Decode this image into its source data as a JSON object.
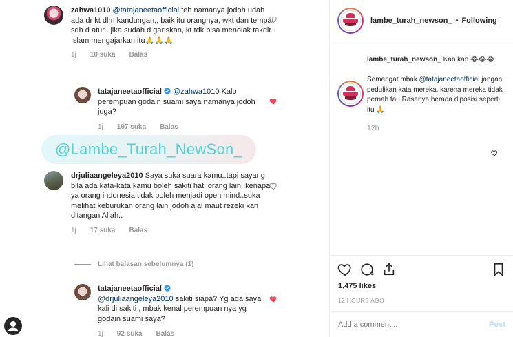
{
  "comments": [
    {
      "username": "zahwa1010",
      "mention": "@tatajaneetaofficial",
      "text": " teh namanya jodoh udah ada dr kt dlm kandungan,, baik itu orangnya, wkt dan tempat sdh d atur.. jika sudah d gariskan, kt tdk bisa menolak takdir.. Islam mengajarkan itu🙏🙏🙏",
      "time": "1j",
      "likes": "10 suka",
      "reply": "Balas"
    },
    {
      "username": "tatajaneetaofficial",
      "mention": "@zahwa1010",
      "text": " Kalo perempuan godain suami saya namanya jodoh juga?",
      "time": "1j",
      "likes": "197 suka",
      "reply": "Balas"
    },
    {
      "username": "drjuliaangeleya2010",
      "mention": "",
      "text": " Saya suka suara kamu..tapi sayang bila ada kata-kata kamu boleh sakiti hati orang lain..kenapa ya orang indonesia tidak boleh menjadi open mind..suka melihat keburukan orang lain jodoh ajal maut rezeki kan ditangan Allah..",
      "time": "1j",
      "likes": "17 suka",
      "reply": "Balas"
    },
    {
      "username": "tatajaneetaofficial",
      "mention": "@drjuliaangeleya2010",
      "text": " sakiti siapa? Yg ada saya kali di sakiti , mbak kenal perempuan nya yg godain suami saya?",
      "time": "1j",
      "likes": "92 suka",
      "reply": "Balas"
    }
  ],
  "banner": "@Lambe_Turah_NewSon_",
  "view_previous": "Lihat balasan sebelumnya (1)",
  "post": {
    "username": "lambe_turah_newson_",
    "dot": "•",
    "follow": "Following",
    "caption_user": "lambe_turah_newson_",
    "caption_text": " Kan kan 😂😂😂",
    "reply_prefix": "Semangat mbak ",
    "reply_mention": "@tatajaneetaofficial",
    "reply_text": " jangan pedulikan kata mereka, karena mereka tidak pernah tau Rasanya berada diposisi seperti itu 🙏",
    "reply_time": "12h",
    "likes": "1,475 likes",
    "ago": "12 HOURS AGO",
    "add_comment_placeholder": "Add a comment...",
    "post_button": "Post"
  },
  "colors": {
    "heart_filled": "#ed4956",
    "mention": "#003569",
    "banner_text": "#4fd4d6"
  }
}
